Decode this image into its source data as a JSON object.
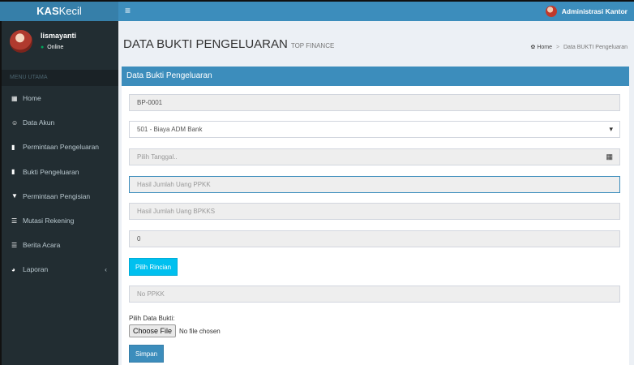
{
  "brand": {
    "bold": "KAS",
    "rest": "Kecil"
  },
  "navbar": {
    "menu_icon": "hamburger-icon",
    "user_label": "Administrasi Kantor"
  },
  "user": {
    "name": "lismayanti",
    "status": "Online"
  },
  "sidebar": {
    "header": "MENU UTAMA",
    "items": [
      {
        "label": "Home",
        "icon": "grid-icon"
      },
      {
        "label": "Data Akun",
        "icon": "users-icon"
      },
      {
        "label": "Permintaan Pengeluaran",
        "icon": "book-icon"
      },
      {
        "label": "Bukti Pengeluaran",
        "icon": "book-icon"
      },
      {
        "label": "Permintaan Pengisian",
        "icon": "filter-icon"
      },
      {
        "label": "Mutasi Rekening",
        "icon": "table-icon"
      },
      {
        "label": "Berita Acara",
        "icon": "table-icon"
      },
      {
        "label": "Laporan",
        "icon": "pie-chart-icon"
      }
    ]
  },
  "page": {
    "title": "DATA BUKTI PENGELUARAN",
    "subtitle": "TOP FINANCE"
  },
  "breadcrumb": {
    "home": "Home",
    "current": "Data BUKTI Pengeluaran"
  },
  "box": {
    "title": "Data Bukti Pengeluaran"
  },
  "form": {
    "nomor": "BP-0001",
    "akun_selected": "501 - Biaya ADM Bank",
    "tanggal_placeholder": "Pilih Tanggal..",
    "ppkk_placeholder": "Hasil Jumlah Uang PPKK",
    "bpkks_placeholder": "Hasil Jumlah Uang BPKKS",
    "total_value": "0",
    "rincian_button": "Pilih Rincian",
    "no_ppkk_placeholder": "No PPKK",
    "file_label": "Pilih Data Bukti:",
    "file_button": "Choose File",
    "file_status": "No file chosen",
    "save_button": "Simpan"
  },
  "colors": {
    "navbar": "#3c8dbc",
    "logo": "#367fa9",
    "sidebar": "#222d32",
    "info_button": "#00c0ef",
    "online": "#00a65a"
  }
}
